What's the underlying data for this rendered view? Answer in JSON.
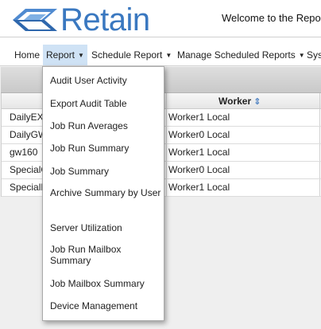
{
  "header": {
    "logo_text": "Retain",
    "welcome_text": "Welcome to the Reporti"
  },
  "nav": {
    "items": [
      {
        "label": "Home",
        "has_caret": false
      },
      {
        "label": "Report",
        "has_caret": true,
        "active": true
      },
      {
        "label": "Schedule Report",
        "has_caret": true
      },
      {
        "label": "Manage Scheduled Reports",
        "has_caret": true
      },
      {
        "label": "Sys",
        "has_caret": false
      }
    ],
    "caret": "▼"
  },
  "table": {
    "columns": [
      "",
      "Worker"
    ],
    "sort_icon": "⇕",
    "rows": [
      {
        "name": "DailyEX",
        "worker": "Worker1 Local"
      },
      {
        "name": "DailyGW",
        "worker": "Worker0 Local"
      },
      {
        "name": "gw160",
        "worker": "Worker1 Local"
      },
      {
        "name": "SpecialG",
        "worker": "Worker0 Local"
      },
      {
        "name": "SpecialE",
        "worker": "Worker1 Local"
      }
    ]
  },
  "dropdown": {
    "items": [
      "Audit User Activity",
      "Export Audit Table",
      "Job Run Averages",
      "Job Run Summary",
      "Job Summary",
      "Archive Summary by User",
      "Server Utilization",
      "Job Run Mailbox Summary",
      "Job Mailbox Summary",
      "Device Management"
    ]
  },
  "colors": {
    "brand_blue": "#3a78c0",
    "active_nav_bg": "#cfe2f5",
    "content_bg": "#efefef"
  }
}
